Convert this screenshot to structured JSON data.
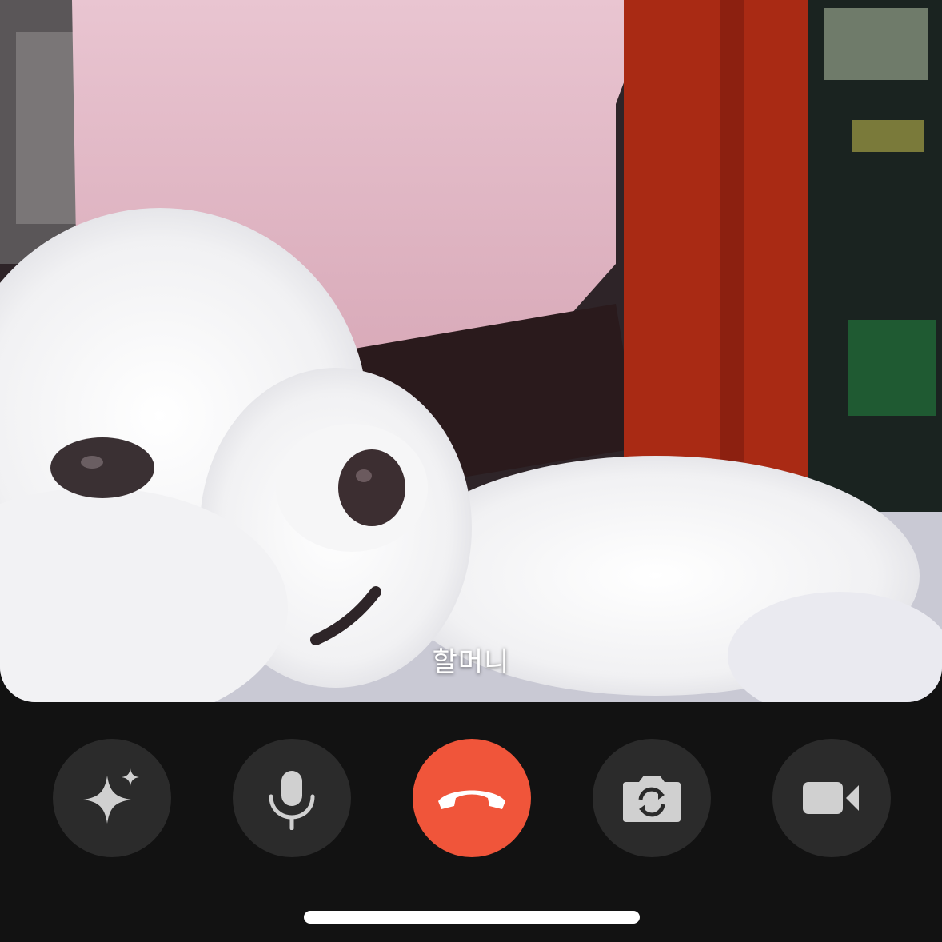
{
  "call": {
    "caller_name": "할머니"
  },
  "controls": [
    {
      "name": "effects-button",
      "icon": "sparkle-icon"
    },
    {
      "name": "mute-button",
      "icon": "microphone-icon"
    },
    {
      "name": "end-call-button",
      "icon": "phone-hangup-icon"
    },
    {
      "name": "flip-camera-button",
      "icon": "camera-flip-icon"
    },
    {
      "name": "video-toggle-button",
      "icon": "video-camera-icon"
    }
  ],
  "colors": {
    "background": "#121212",
    "control_bg": "#2b2b2b",
    "end_call": "#f0553a",
    "icon": "#d0d0d0"
  }
}
